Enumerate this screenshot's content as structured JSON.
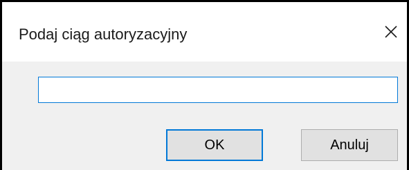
{
  "dialog": {
    "title": "Podaj ciąg autoryzacyjny",
    "close_icon": "close-icon",
    "input": {
      "value": "",
      "placeholder": ""
    },
    "buttons": {
      "ok_label": "OK",
      "cancel_label": "Anuluj"
    }
  },
  "colors": {
    "accent": "#0078d7",
    "titlebar_bg": "#ffffff",
    "client_bg": "#f0f0f0",
    "button_bg": "#e1e1e1",
    "button_border": "#adadad",
    "frame": "#000000"
  }
}
